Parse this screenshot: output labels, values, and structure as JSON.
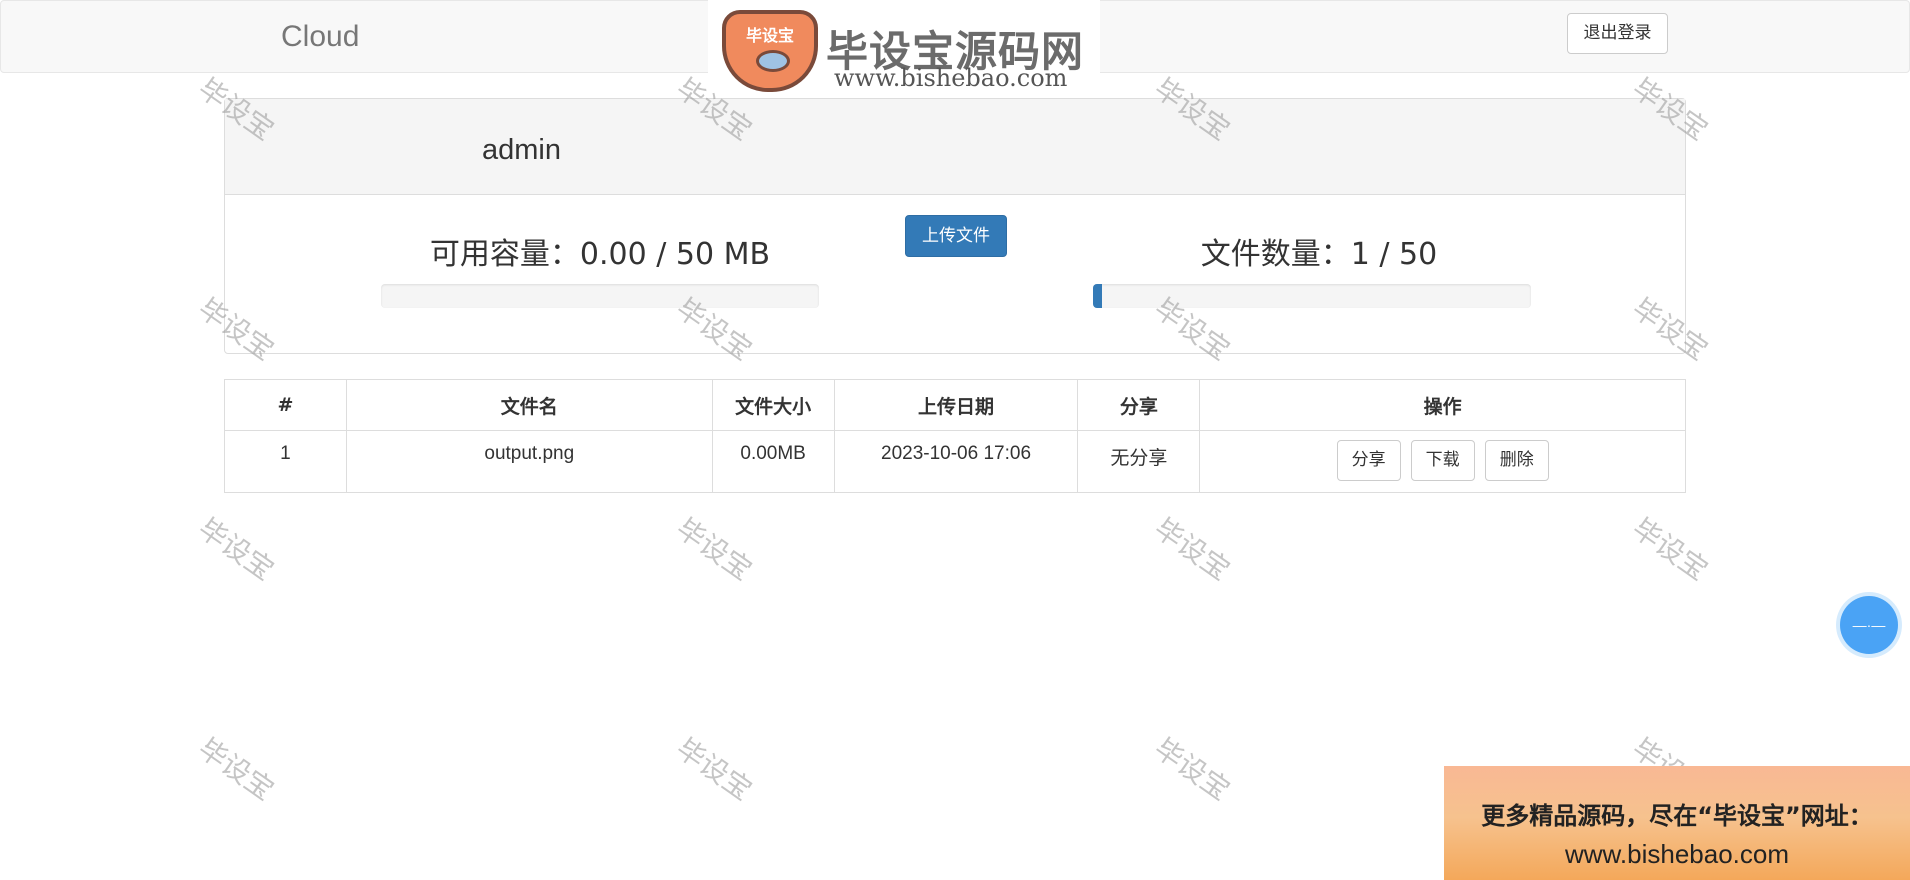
{
  "navbar": {
    "brand": "Cloud",
    "logout_label": "退出登录"
  },
  "logo": {
    "badge_text": "毕设宝",
    "title": "毕设宝源码网",
    "url": "www.bishebao.com"
  },
  "panel": {
    "username": "admin",
    "upload_label": "上传文件",
    "capacity_text": "可用容量：0.00 / 50 MB",
    "capacity_fraction": 0.0,
    "count_text": "文件数量：1 / 50",
    "count_fraction": 0.02
  },
  "table": {
    "headers": [
      "#",
      "文件名",
      "文件大小",
      "上传日期",
      "分享",
      "操作"
    ],
    "rows": [
      {
        "index": "1",
        "name": "output.png",
        "size": "0.00MB",
        "date": "2023-10-06 17:06",
        "share": "无分享",
        "actions": [
          "分享",
          "下载",
          "删除"
        ]
      }
    ]
  },
  "watermark": "毕设宝",
  "float_button": "—·—",
  "banner": {
    "line1": "更多精品源码，尽在“毕设宝”网址：",
    "line2": "www.bishebao.com"
  },
  "colors": {
    "primary": "#337ab7",
    "navbar_bg": "#f8f8f8",
    "panel_heading_bg": "#f5f5f5"
  }
}
